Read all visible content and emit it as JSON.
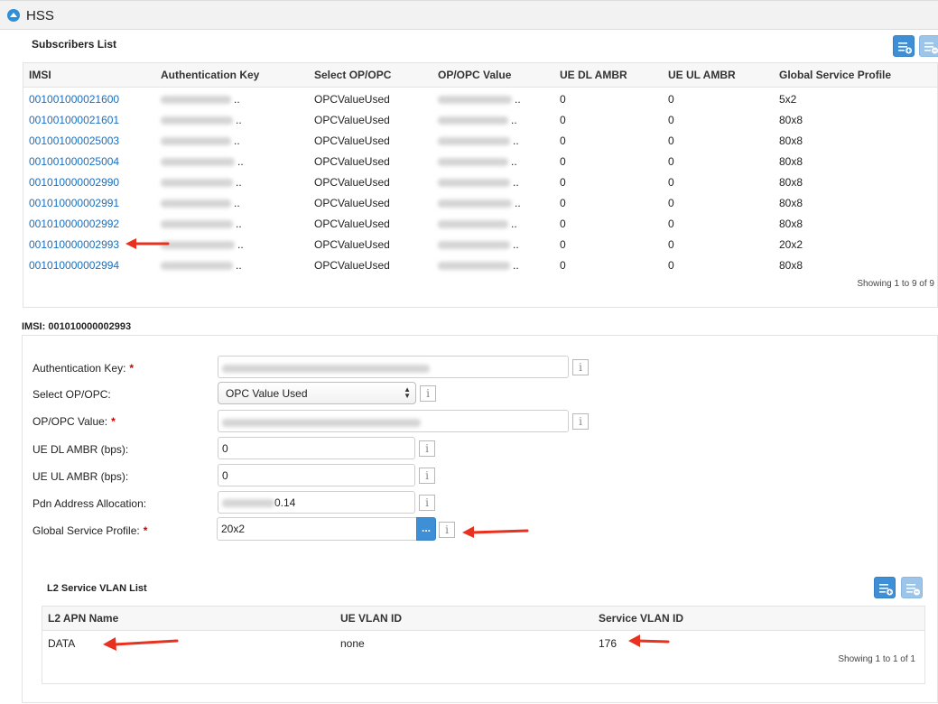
{
  "app": {
    "title": "HSS"
  },
  "subscribers": {
    "title": "Subscribers List",
    "columns": [
      "IMSI",
      "Authentication Key",
      "Select OP/OPC",
      "OP/OPC Value",
      "UE DL AMBR",
      "UE UL AMBR",
      "Global Service Profile"
    ],
    "rows": [
      {
        "imsi": "001001000021600",
        "auth_key": "..",
        "op_opc": "OPCValueUsed",
        "op_value": "..",
        "dl": "0",
        "ul": "0",
        "profile": "5x2"
      },
      {
        "imsi": "001001000021601",
        "auth_key": "..",
        "op_opc": "OPCValueUsed",
        "op_value": "..",
        "dl": "0",
        "ul": "0",
        "profile": "80x8"
      },
      {
        "imsi": "001001000025003",
        "auth_key": "..",
        "op_opc": "OPCValueUsed",
        "op_value": "..",
        "dl": "0",
        "ul": "0",
        "profile": "80x8"
      },
      {
        "imsi": "001001000025004",
        "auth_key": "..",
        "op_opc": "OPCValueUsed",
        "op_value": "..",
        "dl": "0",
        "ul": "0",
        "profile": "80x8"
      },
      {
        "imsi": "001010000002990",
        "auth_key": "..",
        "op_opc": "OPCValueUsed",
        "op_value": "..",
        "dl": "0",
        "ul": "0",
        "profile": "80x8"
      },
      {
        "imsi": "001010000002991",
        "auth_key": "..",
        "op_opc": "OPCValueUsed",
        "op_value": "..",
        "dl": "0",
        "ul": "0",
        "profile": "80x8"
      },
      {
        "imsi": "001010000002992",
        "auth_key": "..",
        "op_opc": "OPCValueUsed",
        "op_value": "..",
        "dl": "0",
        "ul": "0",
        "profile": "80x8"
      },
      {
        "imsi": "001010000002993",
        "auth_key": "..",
        "op_opc": "OPCValueUsed",
        "op_value": "..",
        "dl": "0",
        "ul": "0",
        "profile": "20x2"
      },
      {
        "imsi": "001010000002994",
        "auth_key": "..",
        "op_opc": "OPCValueUsed",
        "op_value": "..",
        "dl": "0",
        "ul": "0",
        "profile": "80x8"
      }
    ],
    "footer": "Showing 1 to 9 of 9"
  },
  "detail": {
    "title": "IMSI: 001010000002993",
    "fields": {
      "auth_key_label": "Authentication Key:",
      "op_opc_label": "Select OP/OPC:",
      "op_opc_value": "OPC Value Used",
      "op_value_label": "OP/OPC Value:",
      "dl_label": "UE DL AMBR (bps):",
      "dl_value": "0",
      "ul_label": "UE UL AMBR (bps):",
      "ul_value": "0",
      "pdn_label": "Pdn Address Allocation:",
      "pdn_value_visible": "0.14",
      "gsp_label": "Global Service Profile:",
      "gsp_value": "20x2",
      "required_mark": "*",
      "info_glyph": "i",
      "browse_label": "..."
    }
  },
  "vlan": {
    "title": "L2 Service VLAN List",
    "columns": [
      "L2 APN Name",
      "UE VLAN ID",
      "Service VLAN ID"
    ],
    "rows": [
      {
        "apn": "DATA",
        "ue_vlan": "none",
        "service_vlan": "176"
      }
    ],
    "footer": "Showing 1 to 1 of 1"
  },
  "colors": {
    "accent": "#3f8fd6",
    "link": "#1a6fbf",
    "annotation_arrow": "#e8321f",
    "required": "#cc0000"
  },
  "icons": [
    "collapse-toggle-icon",
    "add-row-icon",
    "remove-row-icon",
    "info-icon",
    "select-arrows-icon",
    "annotation-arrow-icon"
  ]
}
